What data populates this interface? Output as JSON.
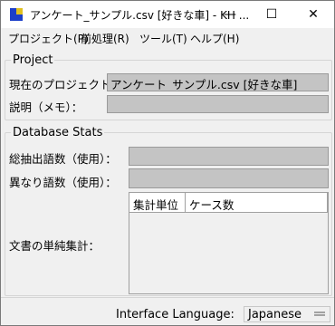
{
  "window": {
    "title": "アンケート_サンプル.csv [好きな車] - KH ..."
  },
  "titlebar_buttons": {
    "minimize": "—",
    "maximize": "☐",
    "close": "✕"
  },
  "menu": [
    "プロジェクト(P)",
    "前処理(R)",
    "ツール(T)",
    "ヘルプ(H)"
  ],
  "project": {
    "legend": "Project",
    "current_label": "現在のプロジェクト：",
    "current_value": "アンケート_サンプル.csv [好きな車]",
    "memo_label": "説明（メモ）：",
    "memo_value": ""
  },
  "stats": {
    "legend": "Database Stats",
    "total_words_label": "総抽出語数（使用）：",
    "total_words_value": "",
    "distinct_words_label": "異なり語数（使用）：",
    "distinct_words_value": "",
    "doc_unit_label": "文書の単純集計：",
    "table_headers": [
      "集計単位",
      "ケース数"
    ]
  },
  "status": {
    "language_label": "Interface Language:",
    "language_value": "Japanese"
  }
}
